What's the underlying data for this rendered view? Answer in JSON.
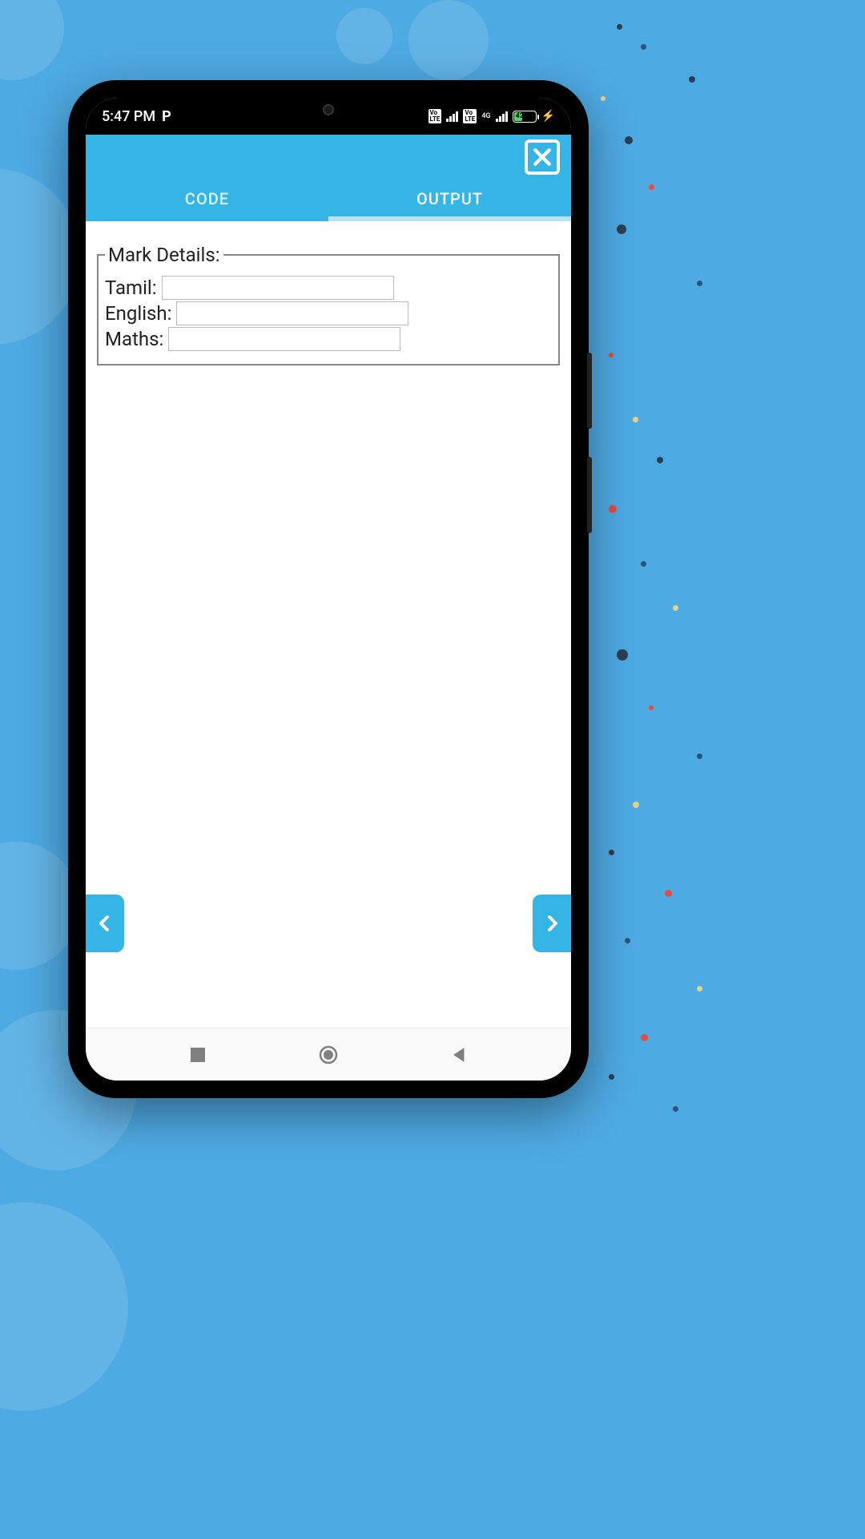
{
  "statusbar": {
    "time": "5:47 PM",
    "network_label": "4G",
    "battery_percent": "42"
  },
  "header": {
    "tabs": {
      "code": "CODE",
      "output": "OUTPUT"
    }
  },
  "form": {
    "legend": "Mark Details:",
    "fields": {
      "tamil": {
        "label": "Tamil:",
        "value": ""
      },
      "english": {
        "label": "English:",
        "value": ""
      },
      "maths": {
        "label": "Maths:",
        "value": ""
      }
    }
  }
}
